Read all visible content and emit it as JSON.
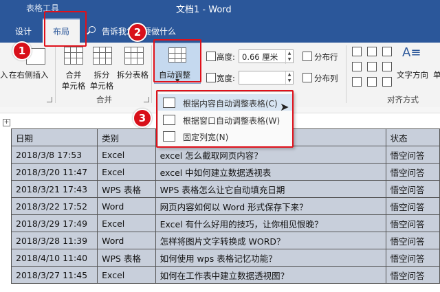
{
  "title_bar": {
    "contextual_tab_group": "表格工具",
    "document_title": "文档1 - Word"
  },
  "tabs": {
    "design": "设计",
    "layout": "布局",
    "tell_me": "告诉我您想要做什么"
  },
  "ribbon": {
    "insert_left_partial": "入",
    "insert_right": "在右侧插入",
    "merge_cells": [
      "合并",
      "单元格"
    ],
    "split_cells": [
      "拆分",
      "单元格"
    ],
    "split_table": "拆分表格",
    "merge_group": "合并",
    "autofit": "自动调整",
    "height_label": "高度:",
    "height_value": "0.66 厘米",
    "width_label": "宽度:",
    "width_value": "",
    "distribute_rows": "分布行",
    "distribute_cols": "分布列",
    "text_direction": "文字方向",
    "alignment_group": "对齐方式",
    "right_partial": "单"
  },
  "autofit_menu": [
    {
      "label": "根据内容自动调整表格(C)",
      "icon": "autofit-contents-icon"
    },
    {
      "label": "根据窗口自动调整表格(W)",
      "icon": "autofit-window-icon"
    },
    {
      "label": "固定列宽(N)",
      "icon": "fixed-column-width-icon"
    }
  ],
  "callouts": [
    "1",
    "2",
    "3"
  ],
  "table": {
    "headers": [
      "日期",
      "类别",
      "",
      "状态"
    ],
    "rows": [
      [
        "2018/3/8 17:53",
        "Excel",
        "excel 怎么截取网页内容？",
        "悟空问答"
      ],
      [
        "2018/3/20 11:47",
        "Excel",
        "excel 中如何建立数据透视表",
        "悟空问答"
      ],
      [
        "2018/3/21 17:43",
        "WPS 表格",
        "WPS 表格怎么让它自动填充日期",
        "悟空问答"
      ],
      [
        "2018/3/22 17:52",
        "Word",
        "网页内容如何以 Word 形式保存下来？",
        "悟空问答"
      ],
      [
        "2018/3/29 17:49",
        "Excel",
        "Excel 有什么好用的技巧，让你相见恨晚？",
        "悟空问答"
      ],
      [
        "2018/3/28 11:39",
        "Word",
        "怎样将图片文字转换成 WORD？",
        "悟空问答"
      ],
      [
        "2018/4/10 11:40",
        "WPS 表格",
        "如何使用 wps 表格记忆功能？",
        "悟空问答"
      ],
      [
        "2018/3/27 11:45",
        "Excel",
        "如何在工作表中建立数据透视图？",
        "悟空问答"
      ]
    ]
  },
  "colors": {
    "accent": "#2b579a",
    "callout_red": "#e0101a",
    "selection": "#c8cfdb"
  }
}
